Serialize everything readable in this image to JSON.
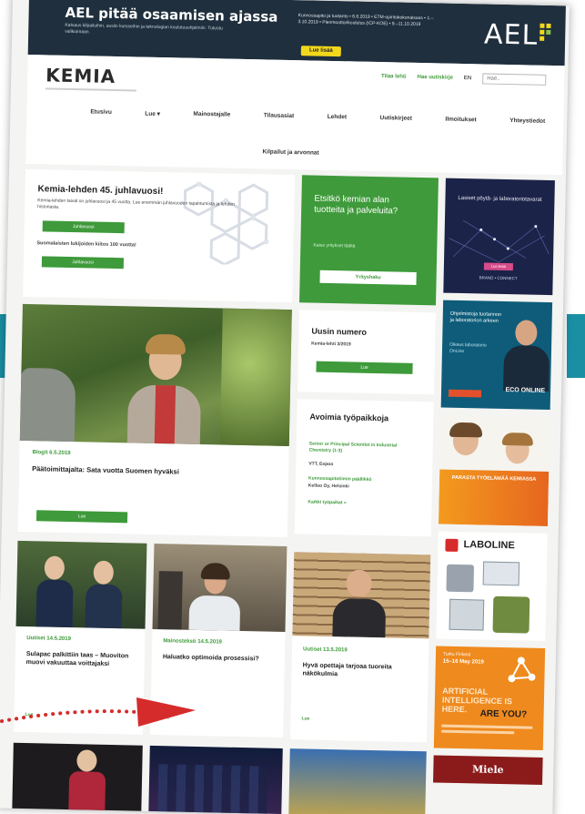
{
  "ael_banner": {
    "headline": "AEL pitää osaamisen ajassa",
    "subtext": "Katsaus kilpailuihin, uusiin kursseihin ja teknologian koulutusohjelmiin. Tutustu valikoimaan.",
    "dates": "Kunnossapito ja tuotanto • 6.6.2019 • ETM-opintokokonaisuus • 1.–3.10.2019 • Pienmoottorikoulutus (ICP-KOE) • 9.–11.10.2019",
    "button": "Lue lisää",
    "logo": "AEL",
    "logo_suffix": "fi",
    "accent": "#f2d81c"
  },
  "header": {
    "logo": "KEMIA",
    "top_links": [
      "Tilaa lehti",
      "Hae uutiskirje",
      "EN"
    ],
    "search_placeholder": "Hae..",
    "nav": [
      "Etusivu",
      "Lue ▾",
      "Mainostajalle",
      "Tilausasiat",
      "Lehdet",
      "Uutiskirjeet",
      "Ilmoitukset",
      "Yhteystiedot"
    ],
    "nav_second_row": "Kilpailut ja arvonnat"
  },
  "anniversary": {
    "title": "Kemia-lehden 45. juhlavuosi!",
    "text": "Kemia-lehden taival on juhlavuosi ja 45 vuotta. Lue enemmän juhlavuoden tapahtumista ja lehden historiasta.",
    "button1": "Juhlavuosi",
    "link_text": "Suomalaisten lukijoiden kiitos 100 vuotta!",
    "button2": "Juhlavuosi"
  },
  "products": {
    "title": "Etsitkö kemian alan tuotteita ja palveluita?",
    "sub": "Katso yritykset täältä",
    "button": "Yrityshaku"
  },
  "latest_issue": {
    "title": "Uusin numero",
    "sub": "Kemia-lehti 3/2019",
    "button": "Lue"
  },
  "jobs": {
    "title": "Avoimia työpaikkoja",
    "job1": "Senior or Principal Scientist in Industrial Chemistry (1-3)",
    "job1_company": "VTT, Espoo",
    "job2": "Kunnossapitotiimin päällikkö",
    "job2_company": "Kelloo Oy, Helsinki",
    "all": "Kaikki työpaikat »"
  },
  "feature": {
    "category": "Blogit 6.5.2019",
    "title": "Päätoimittajalta: Sata vuotta Suomen hyväksi",
    "button": "Lue"
  },
  "articles": [
    {
      "meta": "Uutiset 14.5.2019",
      "title": "Sulapac palkittiin taas – Muoviton muovi vakuuttaa voittajaksi",
      "link": "Lue"
    },
    {
      "meta": "Mainosteksti 14.5.2019",
      "title": "Haluatko optimoida prosessisi?",
      "link": "Lue"
    },
    {
      "meta": "Uutiset 13.5.2019",
      "title": "Hyvä opettaja tarjoaa tuoreita näkökulmia",
      "link": "Lue"
    }
  ],
  "ads": {
    "ad1_title": "Lasiset pöytä- ja laboratoriotavarat",
    "ad1_tag": "Lue lisää",
    "ad1_brand": "BRAND • CONNECT",
    "ad2_text": "Ohjelmistoja tuotannon ja laboratorion arkeen",
    "ad2_sub": "Oikeus laboratorio OnLine",
    "ad2_brand": "ECO ONLINE",
    "ad3_text": "PARASTA TYÖELÄMÄÄ KEMIASSA",
    "ad4_brand": "LABOLINE",
    "ad5_top": "Turku Finland",
    "ad5_dates": "15–16 May 2019",
    "ad5_main": "ARTIFICIAL INTELLIGENCE IS HERE.",
    "ad5_question": "ARE YOU?",
    "ad6_brand": "Miele"
  },
  "colors": {
    "green": "#3e9a3a",
    "teal": "#1a8fa3",
    "arrow": "#d62b2b"
  }
}
